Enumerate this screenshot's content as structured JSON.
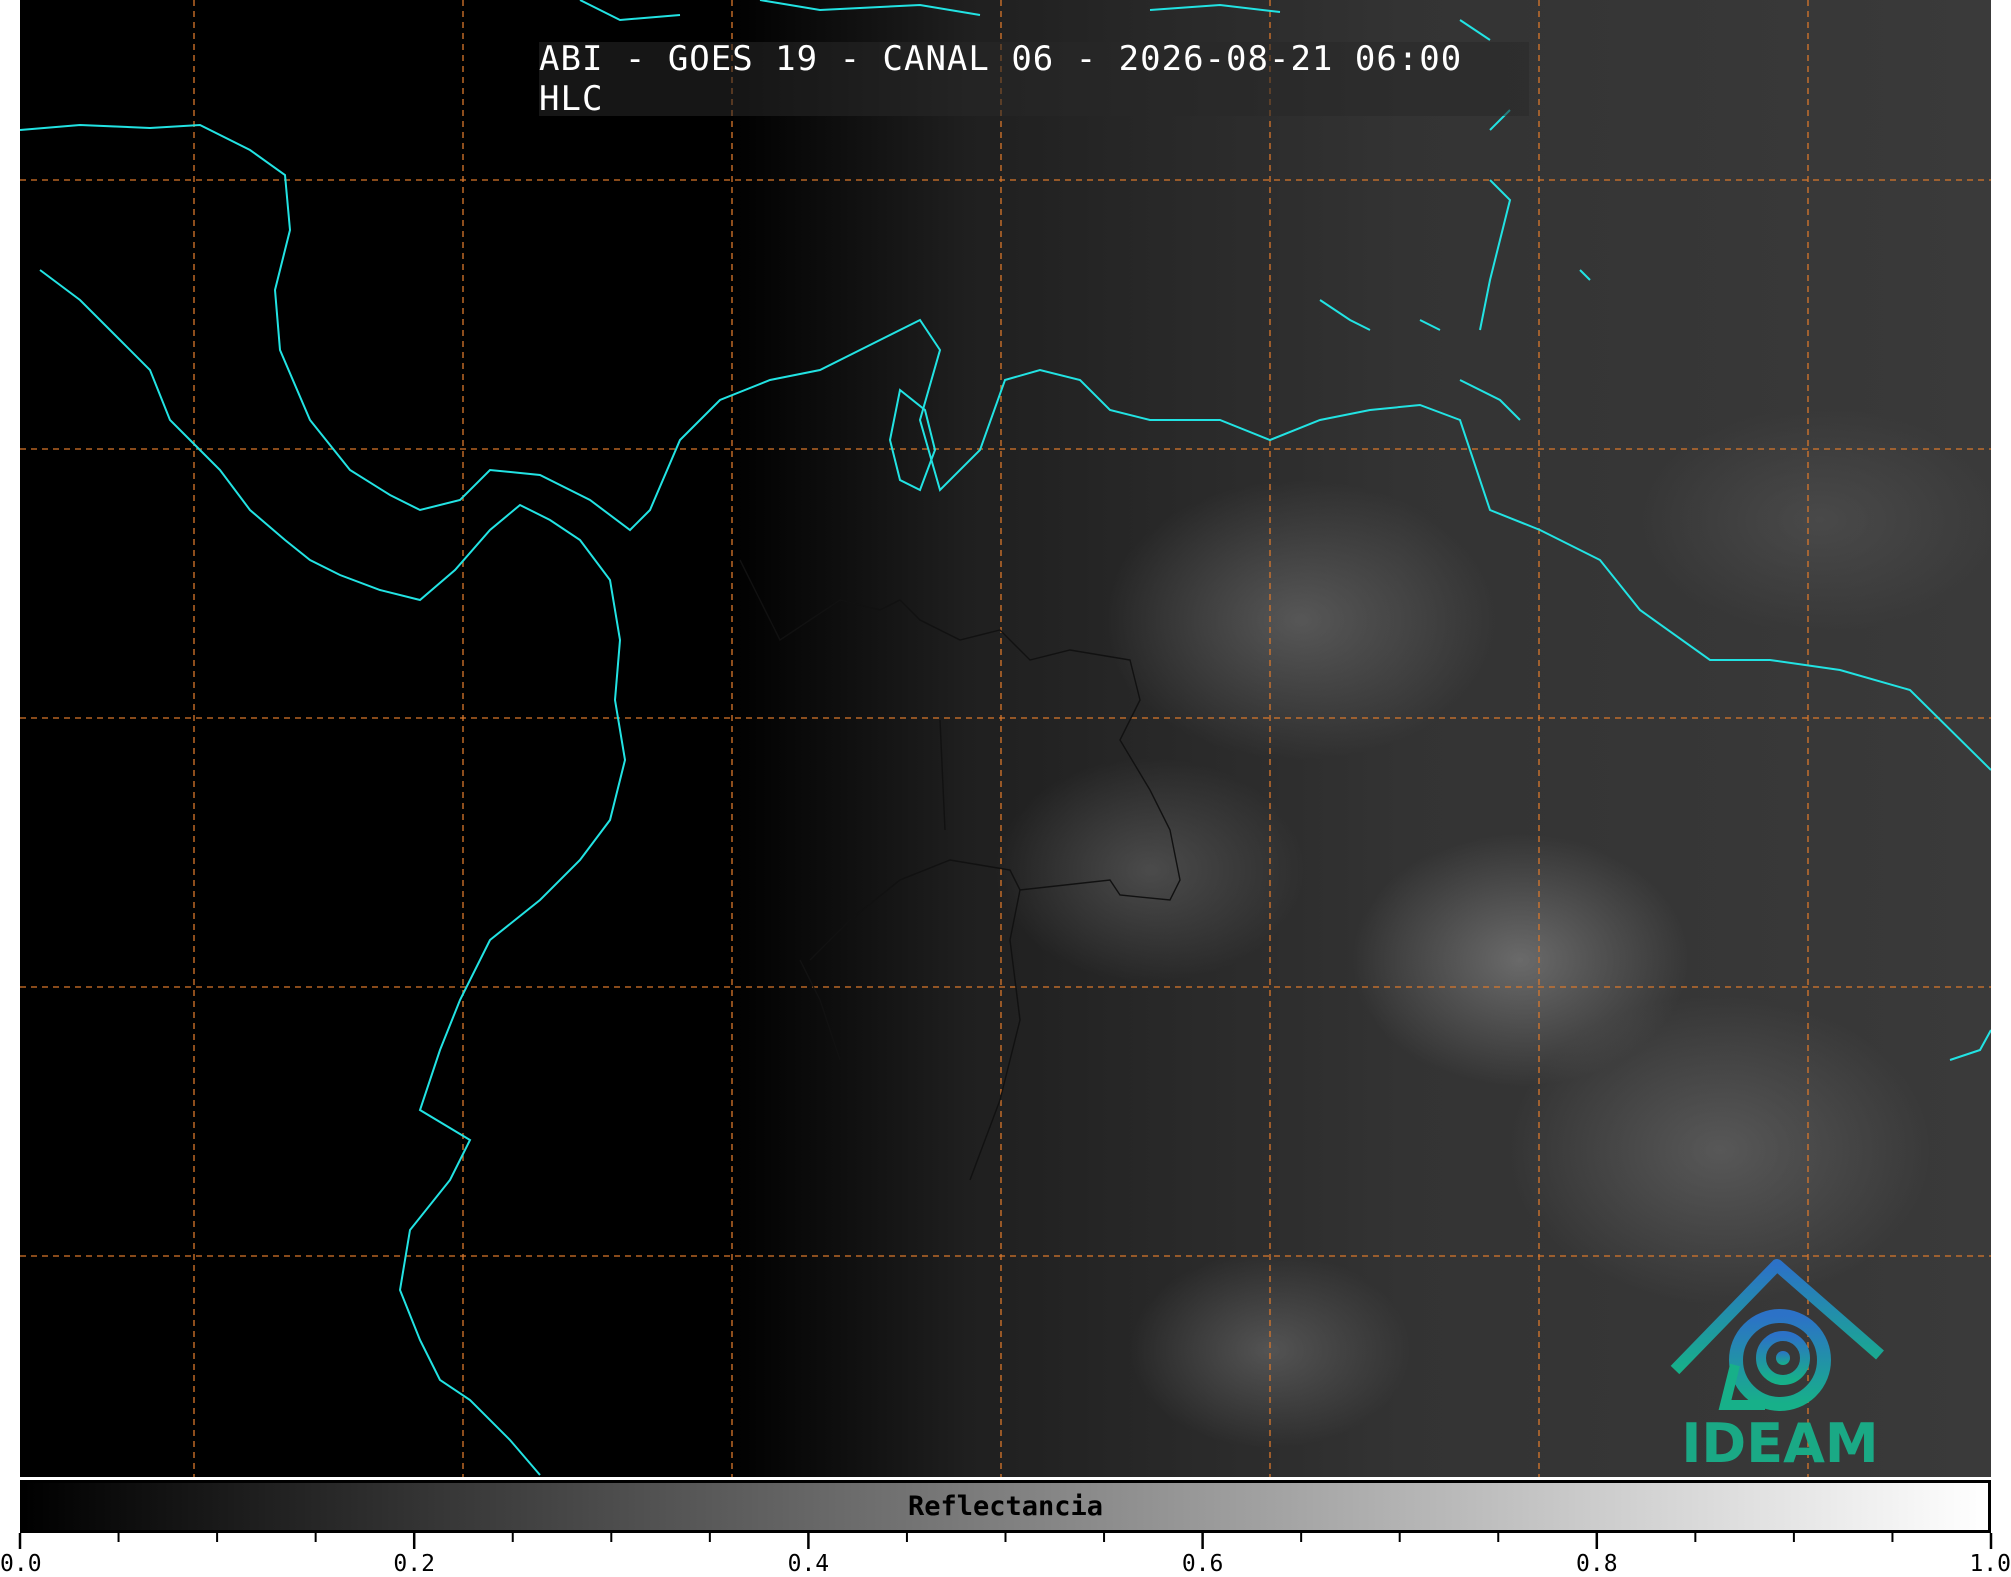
{
  "title": "ABI - GOES 19 - CANAL 06 - 2026-08-21 06:00 HLC",
  "colorbar": {
    "label": "Reflectancia",
    "min": 0.0,
    "max": 1.0,
    "colormap_start": "#000000",
    "colormap_end": "#ffffff",
    "tick_labels": [
      "0.0",
      "0.2",
      "0.4",
      "0.6",
      "0.8",
      "1.0"
    ],
    "tick_values": [
      0.0,
      0.2,
      0.4,
      0.6,
      0.8,
      1.0
    ],
    "minor_tick_step": 0.05
  },
  "logo": {
    "text": "IDEAM",
    "icon": "ideam-volcano-spiral-logo",
    "color": "#1aa985"
  },
  "map": {
    "coastline_color": "#22e3e3",
    "gridline_color": "#d9772b",
    "border_color": "#111111",
    "grid_style": "dashed"
  }
}
